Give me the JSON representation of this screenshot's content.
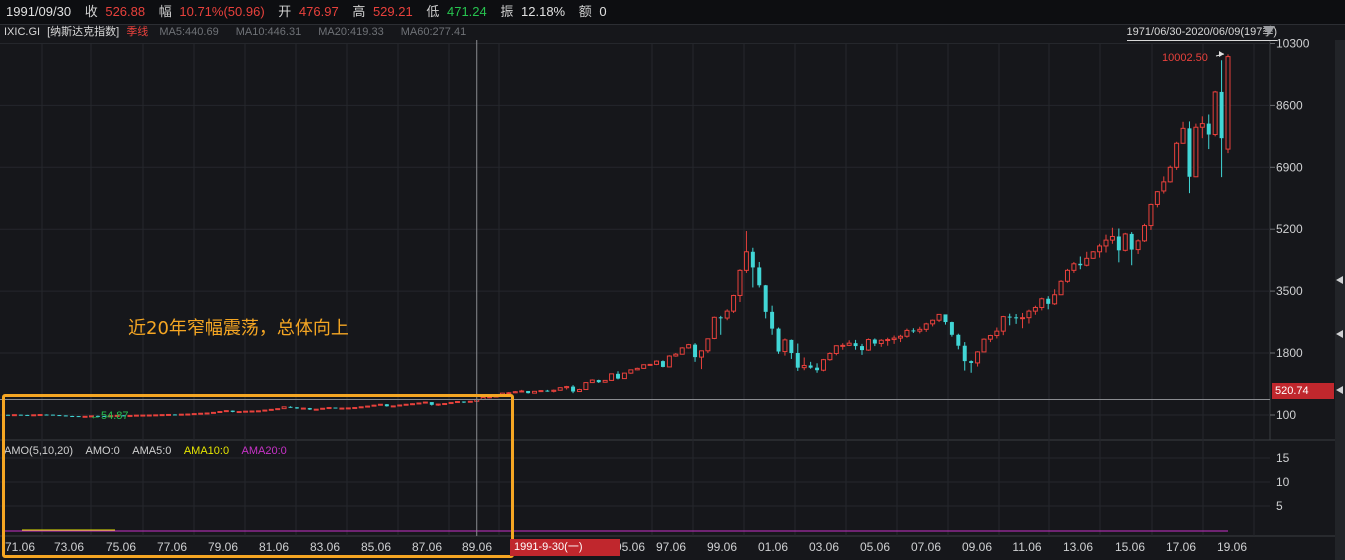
{
  "header": {
    "date": "1991/09/30",
    "close_label": "收",
    "close_value": "526.88",
    "change_label": "幅",
    "change_value": "10.71%(50.96)",
    "open_label": "开",
    "open_value": "476.97",
    "high_label": "高",
    "high_value": "529.21",
    "low_label": "低",
    "low_value": "471.24",
    "amp_label": "振",
    "amp_value": "12.18%",
    "amount_label": "额",
    "amount_value": "0"
  },
  "info": {
    "code": "IXIC.GI",
    "name": "[纳斯达克指数]",
    "period": "季线",
    "ma5": "MA5:440.69",
    "ma10": "MA10:446.31",
    "ma20": "MA20:419.33",
    "ma60": "MA60:277.41",
    "range": "1971/06/30-2020/06/09(197季)"
  },
  "annotation": "近20年窄幅震荡，总体向上",
  "crosshair": {
    "date_label": "1991-9-30(一)",
    "price_label": "520.74"
  },
  "amo": {
    "title": "AMO(5,10,20)",
    "amo": "AMO:0",
    "ama5": "AMA5:0",
    "ama10": "AMA10:0",
    "ama20": "AMA20:0"
  },
  "colors": {
    "up": "#e8413c",
    "down": "#41d6d6",
    "bg": "#16171b",
    "highlight": "#f5a623",
    "ama10": "#e6e600",
    "ama20": "#c832c8"
  },
  "chart_data": [
    {
      "type": "candlestick",
      "title": "IXIC.GI [纳斯达克指数] 季线",
      "y_ticks": [
        "10300",
        "8600",
        "6900",
        "5200",
        "3500",
        "1800",
        "100"
      ],
      "x_tick_labels": [
        "71.06",
        "73.06",
        "75.06",
        "77.06",
        "79.06",
        "81.06",
        "83.06",
        "85.06",
        "87.06",
        "89.06",
        "95.06",
        "97.06",
        "99.06",
        "01.06",
        "03.06",
        "05.06",
        "07.06",
        "09.06",
        "11.06",
        "13.06",
        "15.06",
        "17.06",
        "19.06"
      ],
      "annotations": {
        "high": "10002.50",
        "low": "54.87"
      },
      "ohlc": [
        [
          106,
          108,
          100,
          104
        ],
        [
          104,
          112,
          102,
          109
        ],
        [
          109,
          111,
          101,
          102
        ],
        [
          102,
          104,
          97,
          100
        ],
        [
          100,
          108,
          98,
          106
        ],
        [
          106,
          115,
          104,
          113
        ],
        [
          113,
          117,
          109,
          110
        ],
        [
          110,
          112,
          95,
          98
        ],
        [
          98,
          101,
          86,
          88
        ],
        [
          88,
          90,
          70,
          73
        ],
        [
          73,
          78,
          66,
          70
        ],
        [
          70,
          72,
          54.87,
          56
        ],
        [
          56,
          66,
          55,
          64
        ],
        [
          64,
          78,
          62,
          76
        ],
        [
          76,
          84,
          72,
          74
        ],
        [
          74,
          77,
          68,
          70
        ],
        [
          70,
          82,
          69,
          80
        ],
        [
          80,
          92,
          78,
          90
        ],
        [
          90,
          93,
          84,
          86
        ],
        [
          86,
          90,
          79,
          88
        ],
        [
          88,
          98,
          86,
          96
        ],
        [
          96,
          100,
          92,
          98
        ],
        [
          98,
          102,
          94,
          100
        ],
        [
          100,
          106,
          97,
          104
        ],
        [
          104,
          112,
          102,
          110
        ],
        [
          110,
          118,
          106,
          115
        ],
        [
          115,
          120,
          110,
          112
        ],
        [
          112,
          125,
          110,
          122
        ],
        [
          122,
          130,
          118,
          126
        ],
        [
          126,
          140,
          124,
          138
        ],
        [
          138,
          150,
          134,
          148
        ],
        [
          148,
          160,
          140,
          155
        ],
        [
          155,
          175,
          150,
          172
        ],
        [
          172,
          200,
          168,
          196
        ],
        [
          196,
          225,
          190,
          220
        ],
        [
          220,
          225,
          175,
          185
        ],
        [
          185,
          200,
          180,
          195
        ],
        [
          195,
          210,
          190,
          205
        ],
        [
          205,
          215,
          198,
          210
        ],
        [
          210,
          220,
          200,
          215
        ],
        [
          215,
          240,
          210,
          235
        ],
        [
          235,
          260,
          230,
          255
        ],
        [
          255,
          280,
          250,
          275
        ],
        [
          275,
          330,
          270,
          325
        ],
        [
          325,
          340,
          300,
          310
        ],
        [
          310,
          320,
          270,
          280
        ],
        [
          280,
          300,
          270,
          290
        ],
        [
          290,
          295,
          240,
          250
        ],
        [
          250,
          265,
          240,
          260
        ],
        [
          260,
          290,
          255,
          285
        ],
        [
          285,
          310,
          280,
          305
        ],
        [
          305,
          290,
          280,
          285
        ],
        [
          285,
          300,
          270,
          290
        ],
        [
          290,
          300,
          280,
          295
        ],
        [
          295,
          310,
          290,
          305
        ],
        [
          305,
          330,
          295,
          325
        ],
        [
          325,
          350,
          320,
          345
        ],
        [
          345,
          380,
          340,
          370
        ],
        [
          370,
          400,
          360,
          395
        ],
        [
          395,
          400,
          330,
          340
        ],
        [
          340,
          360,
          320,
          350
        ],
        [
          350,
          380,
          345,
          375
        ],
        [
          375,
          400,
          370,
          395
        ],
        [
          395,
          420,
          385,
          410
        ],
        [
          410,
          440,
          400,
          430
        ],
        [
          430,
          460,
          420,
          455
        ],
        [
          455,
          440,
          360,
          380
        ],
        [
          380,
          410,
          350,
          400
        ],
        [
          400,
          420,
          390,
          415
        ],
        [
          415,
          450,
          410,
          445
        ],
        [
          445,
          480,
          440,
          470
        ],
        [
          470,
          475,
          430,
          460
        ],
        [
          460,
          480,
          450,
          476.97
        ],
        [
          476.97,
          529.21,
          471.24,
          526.88
        ],
        [
          526.88,
          600,
          510,
          580
        ],
        [
          580,
          620,
          560,
          600
        ],
        [
          600,
          640,
          590,
          620
        ],
        [
          620,
          710,
          610,
          700
        ],
        [
          700,
          730,
          680,
          710
        ],
        [
          710,
          760,
          700,
          740
        ],
        [
          740,
          790,
          720,
          760
        ],
        [
          760,
          750,
          690,
          700
        ],
        [
          700,
          760,
          690,
          750
        ],
        [
          750,
          780,
          740,
          770
        ],
        [
          770,
          790,
          740,
          750
        ],
        [
          750,
          800,
          720,
          780
        ],
        [
          780,
          860,
          770,
          850
        ],
        [
          850,
          900,
          800,
          880
        ],
        [
          880,
          920,
          700,
          745
        ],
        [
          745,
          820,
          740,
          800
        ],
        [
          800,
          1000,
          790,
          990
        ],
        [
          990,
          1080,
          980,
          1060
        ],
        [
          1060,
          1070,
          980,
          1000
        ],
        [
          1000,
          1060,
          990,
          1050
        ],
        [
          1050,
          1240,
          1040,
          1230
        ],
        [
          1230,
          1300,
          1080,
          1100
        ],
        [
          1100,
          1260,
          1090,
          1250
        ],
        [
          1250,
          1350,
          1230,
          1340
        ],
        [
          1340,
          1400,
          1330,
          1380
        ],
        [
          1380,
          1490,
          1370,
          1480
        ],
        [
          1480,
          1500,
          1470,
          1490
        ],
        [
          1490,
          1600,
          1470,
          1580
        ],
        [
          1580,
          1600,
          1410,
          1420
        ],
        [
          1420,
          1740,
          1410,
          1720
        ],
        [
          1720,
          1800,
          1700,
          1770
        ],
        [
          1770,
          1960,
          1760,
          1940
        ],
        [
          1940,
          2050,
          1920,
          2030
        ],
        [
          2030,
          2070,
          1560,
          1690
        ],
        [
          1690,
          1870,
          1360,
          1860
        ],
        [
          1860,
          2200,
          1800,
          2190
        ],
        [
          2200,
          2800,
          2180,
          2780
        ],
        [
          2780,
          2820,
          2300,
          2760
        ],
        [
          2760,
          3000,
          2700,
          2950
        ],
        [
          2950,
          3400,
          2900,
          3380
        ],
        [
          3380,
          4100,
          3200,
          4070
        ],
        [
          4070,
          5150,
          4000,
          4580
        ],
        [
          4580,
          4690,
          3600,
          4150
        ],
        [
          4150,
          4300,
          3600,
          3660
        ],
        [
          3660,
          3670,
          2750,
          2930
        ],
        [
          2930,
          3100,
          2300,
          2470
        ],
        [
          2470,
          2500,
          1780,
          1840
        ],
        [
          1840,
          2200,
          1730,
          2160
        ],
        [
          2160,
          2170,
          1640,
          1800
        ],
        [
          1800,
          2060,
          1310,
          1400
        ],
        [
          1400,
          1680,
          1330,
          1460
        ],
        [
          1460,
          1560,
          1370,
          1400
        ],
        [
          1400,
          1520,
          1260,
          1330
        ],
        [
          1330,
          1640,
          1300,
          1620
        ],
        [
          1620,
          1820,
          1590,
          1790
        ],
        [
          1790,
          2010,
          1740,
          2000
        ],
        [
          2000,
          2070,
          1890,
          2010
        ],
        [
          2010,
          2150,
          1990,
          2070
        ],
        [
          2070,
          2160,
          1890,
          1990
        ],
        [
          1990,
          2050,
          1750,
          1880
        ],
        [
          1880,
          2200,
          1860,
          2170
        ],
        [
          2170,
          2200,
          1990,
          2060
        ],
        [
          2060,
          2180,
          1970,
          2150
        ],
        [
          2150,
          2220,
          2000,
          2170
        ],
        [
          2170,
          2280,
          2050,
          2210
        ],
        [
          2210,
          2300,
          2100,
          2260
        ],
        [
          2260,
          2470,
          2220,
          2420
        ],
        [
          2420,
          2480,
          2350,
          2400
        ],
        [
          2400,
          2520,
          2340,
          2450
        ],
        [
          2450,
          2630,
          2380,
          2600
        ],
        [
          2600,
          2720,
          2530,
          2700
        ],
        [
          2700,
          2870,
          2650,
          2860
        ],
        [
          2860,
          2760,
          2580,
          2650
        ],
        [
          2650,
          2660,
          2250,
          2300
        ],
        [
          2300,
          2330,
          1900,
          2000
        ],
        [
          2000,
          2100,
          1320,
          1580
        ],
        [
          1580,
          1600,
          1260,
          1530
        ],
        [
          1530,
          1850,
          1430,
          1830
        ],
        [
          1830,
          2200,
          1820,
          2180
        ],
        [
          2180,
          2300,
          2100,
          2280
        ],
        [
          2280,
          2500,
          2200,
          2400
        ],
        [
          2400,
          2820,
          2290,
          2800
        ],
        [
          2800,
          2880,
          2560,
          2780
        ],
        [
          2780,
          2870,
          2600,
          2770
        ],
        [
          2770,
          2900,
          2480,
          2770
        ],
        [
          2770,
          2990,
          2610,
          2950
        ],
        [
          2950,
          3100,
          2850,
          3050
        ],
        [
          3050,
          3320,
          2970,
          3290
        ],
        [
          3290,
          3360,
          3000,
          3150
        ],
        [
          3150,
          3550,
          3120,
          3400
        ],
        [
          3400,
          3800,
          3390,
          3770
        ],
        [
          3770,
          4110,
          3730,
          4070
        ],
        [
          4070,
          4300,
          4000,
          4250
        ],
        [
          4250,
          4450,
          4100,
          4210
        ],
        [
          4210,
          4580,
          4180,
          4400
        ],
        [
          4400,
          4600,
          4390,
          4580
        ],
        [
          4580,
          4800,
          4420,
          4740
        ],
        [
          4740,
          5050,
          4560,
          4900
        ],
        [
          4900,
          5240,
          4800,
          5000
        ],
        [
          5000,
          5220,
          4290,
          4620
        ],
        [
          4620,
          5100,
          4590,
          5070
        ],
        [
          5070,
          5120,
          4210,
          4640
        ],
        [
          4640,
          4920,
          4520,
          4880
        ],
        [
          4880,
          5350,
          4850,
          5300
        ],
        [
          5300,
          5900,
          5180,
          5880
        ],
        [
          5880,
          6250,
          5800,
          6230
        ],
        [
          6250,
          6650,
          6180,
          6500
        ],
        [
          6500,
          6950,
          6480,
          6900
        ],
        [
          6900,
          7600,
          6830,
          7560
        ],
        [
          7560,
          8150,
          7550,
          7970
        ],
        [
          7970,
          8160,
          6190,
          6640
        ],
        [
          6640,
          8100,
          6630,
          8000
        ],
        [
          8000,
          8300,
          7700,
          8100
        ],
        [
          8100,
          8350,
          7400,
          7800
        ],
        [
          7800,
          9000,
          7750,
          8970
        ],
        [
          8970,
          9840,
          6630,
          7700
        ],
        [
          7400,
          10002.5,
          7290,
          9940
        ]
      ]
    }
  ]
}
